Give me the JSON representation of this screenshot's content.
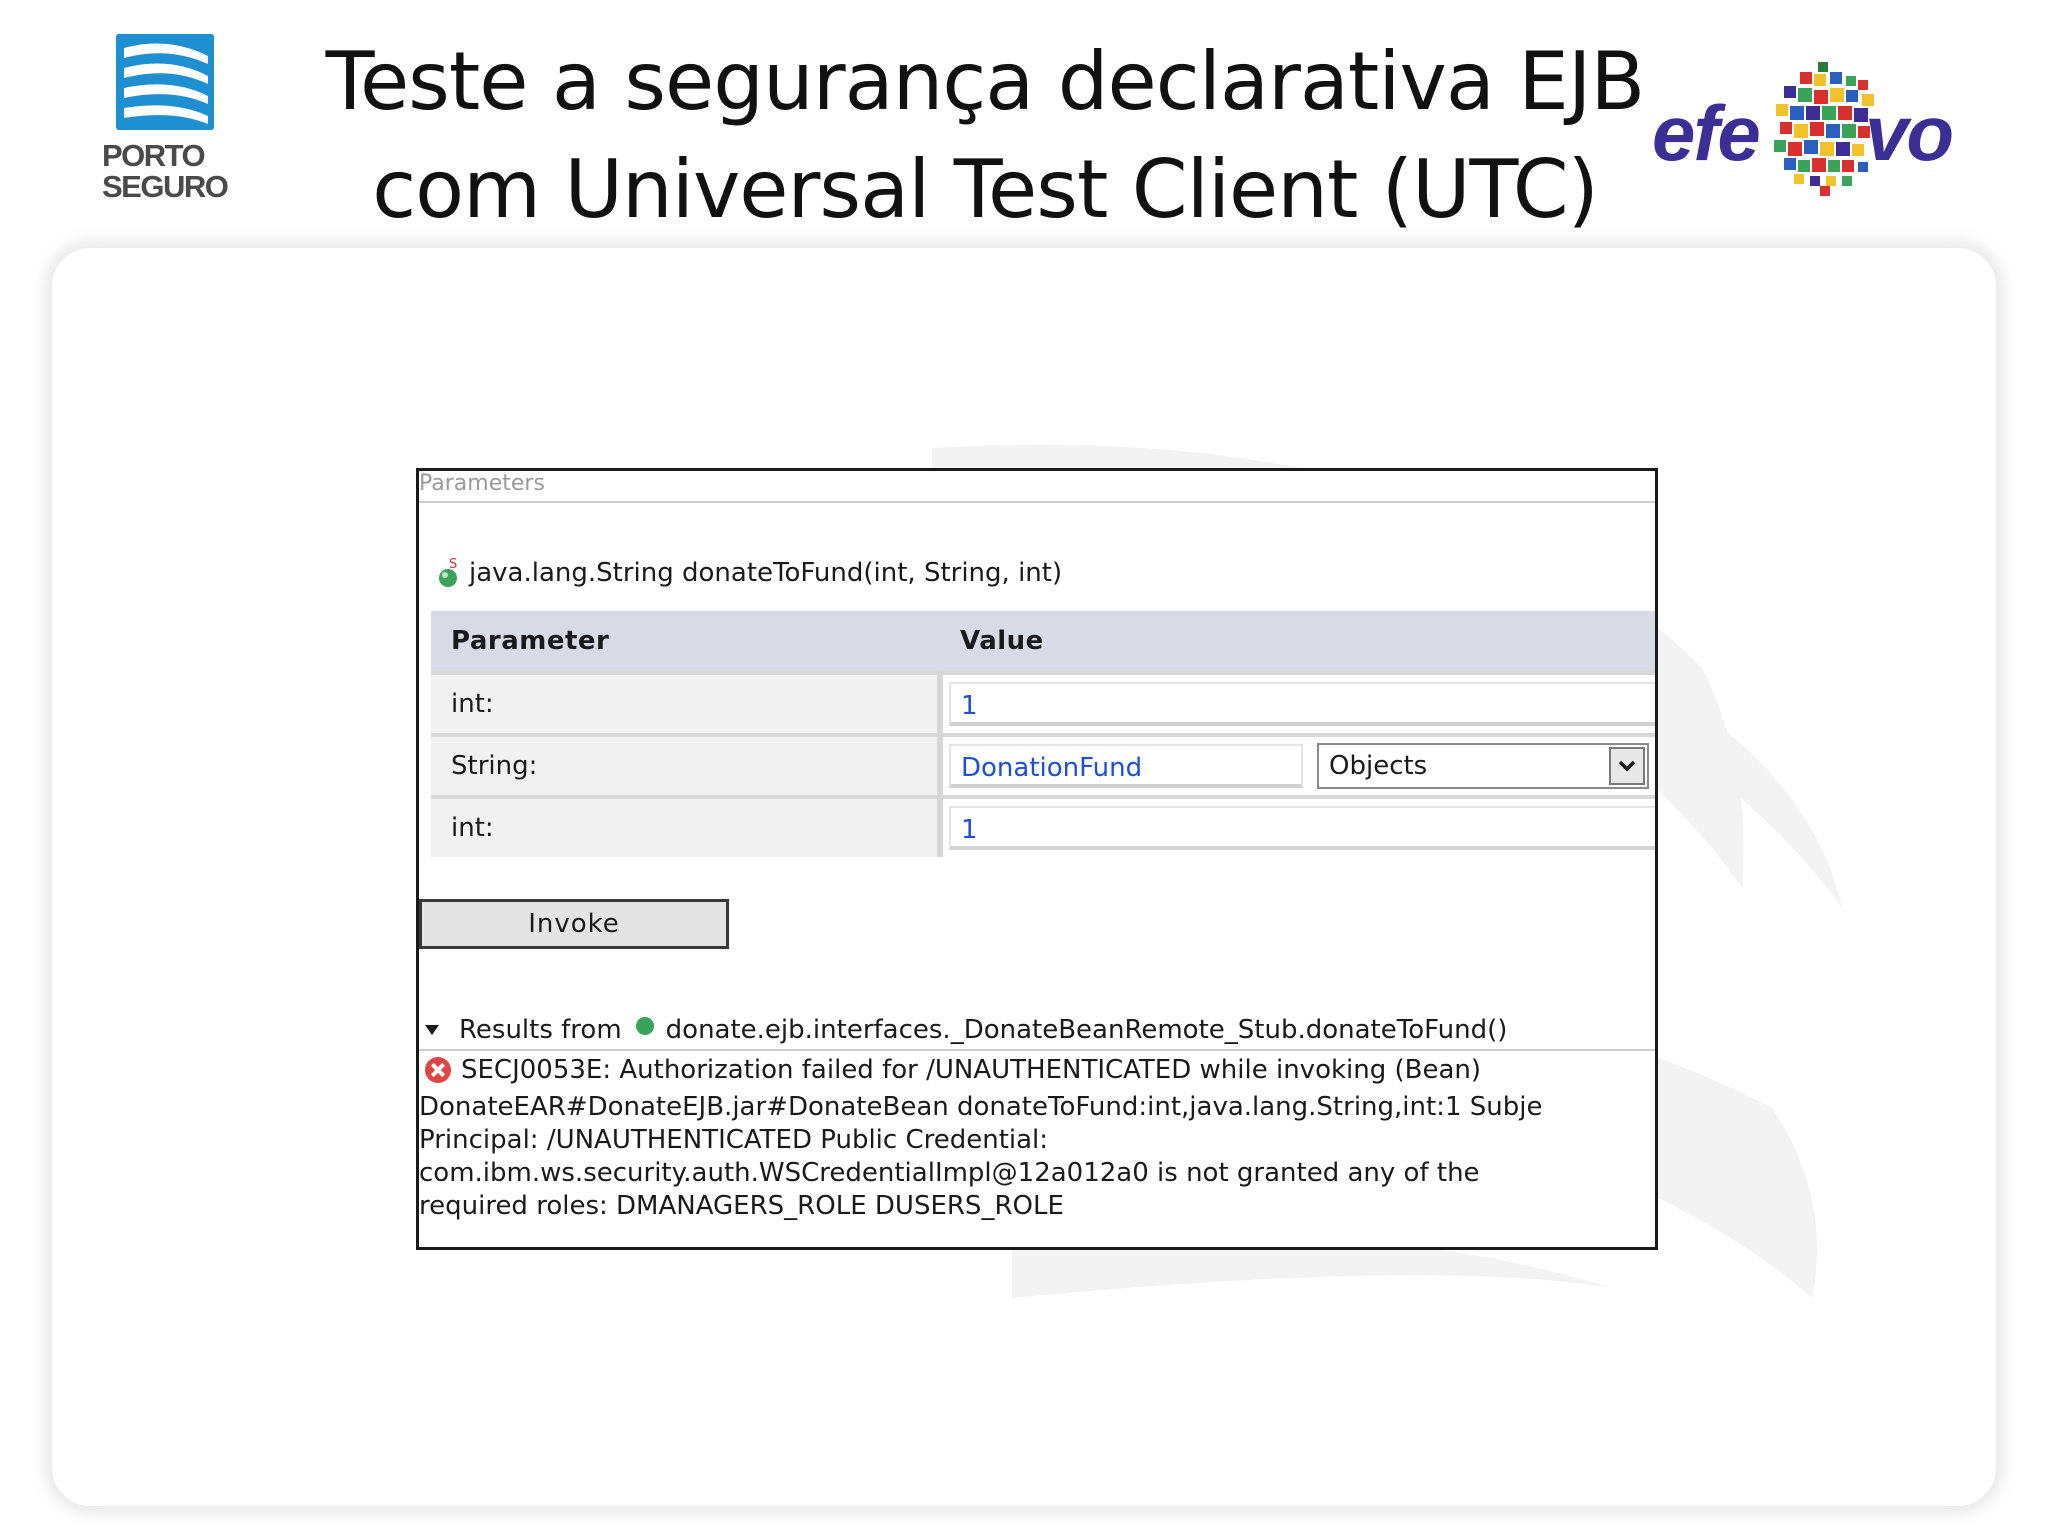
{
  "slide": {
    "title_line1": "Teste a segurança declarativa EJB",
    "title_line2": "com Universal Test Client (UTC)"
  },
  "logos": {
    "left": {
      "line1": "PORTO",
      "line2": "SEGURO",
      "color": "#1e8fd0"
    },
    "right": {
      "word_left": "efe",
      "word_right": "vo",
      "color": "#3b2f95"
    }
  },
  "utc": {
    "panel_title": "Parameters",
    "method_signature": "java.lang.String donateToFund(int, String, int)",
    "table": {
      "headers": [
        "Parameter",
        "Value"
      ],
      "rows": [
        {
          "name": "int:",
          "value": "1"
        },
        {
          "name": "String:",
          "value": "DonationFund",
          "select": "Objects"
        },
        {
          "name": "int:",
          "value": "1"
        }
      ]
    },
    "invoke_label": "Invoke",
    "results_label": "Results from",
    "results_target": "donate.ejb.interfaces._DonateBeanRemote_Stub.donateToFund()",
    "error_line": "SECJ0053E: Authorization failed for /UNAUTHENTICATED while invoking (Bean)",
    "error_body": [
      "DonateEAR#DonateEJB.jar#DonateBean donateToFund:int,java.lang.String,int:1 Subje",
      "Principal: /UNAUTHENTICATED Public Credential:",
      "com.ibm.ws.security.auth.WSCredentialImpl@12a012a0 is not granted any of the",
      "required roles: DMANAGERS_ROLE DUSERS_ROLE"
    ],
    "colors": {
      "value_text": "#1f4fd6",
      "header_bg": "#d8dbe6",
      "error_icon": "#e04545",
      "result_dot": "#3aa35a"
    }
  }
}
